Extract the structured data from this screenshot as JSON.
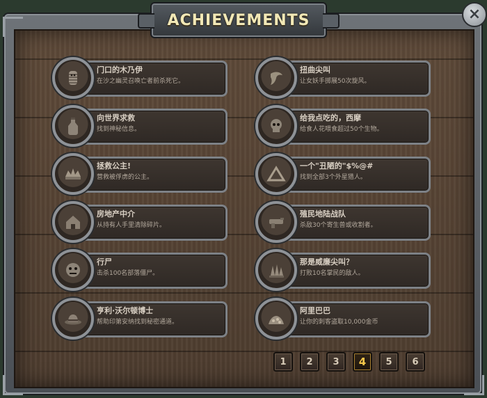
{
  "title": "ACHIEVEMENTS",
  "close_label": "×",
  "colors": {
    "wood": "#4d3c2f",
    "frame": "#6e7378",
    "active_page": "#f5c64a"
  },
  "achievements": [
    {
      "title": "门口的木乃伊",
      "desc": "在沙之幽灵召唤亡者前杀死它。",
      "icon": "mummy-icon"
    },
    {
      "title": "扭曲尖叫",
      "desc": "让女妖手掷展50次旋风。",
      "icon": "banshee-icon"
    },
    {
      "title": "向世界求救",
      "desc": "找到神秘信息。",
      "icon": "bottle-icon"
    },
    {
      "title": "给我点吃的，西摩",
      "desc": "给食人花喂食超过50个生物。",
      "icon": "skull-icon"
    },
    {
      "title": "拯救公主!",
      "desc": "营救被俘虏的公主。",
      "icon": "crown-icon"
    },
    {
      "title": "一个\"丑陋的\"$%@#",
      "desc": "找到全部3个外星猎人。",
      "icon": "triangle-icon"
    },
    {
      "title": "房地产中介",
      "desc": "从持有人手里清除碎片。",
      "icon": "house-icon"
    },
    {
      "title": "殖民地陆战队",
      "desc": "杀敌30个寄生兽或收割者。",
      "icon": "gun-icon"
    },
    {
      "title": "行尸",
      "desc": "击杀100名部落僵尸。",
      "icon": "zombie-icon"
    },
    {
      "title": "那是威廉尖叫？",
      "desc": "打败10名掌民的敌人。",
      "icon": "spikes-icon"
    },
    {
      "title": "亨利·沃尔顿博士",
      "desc": "帮助印第安纳找到秘密通道。",
      "icon": "hat-icon"
    },
    {
      "title": "阿里巴巴",
      "desc": "让你的刺客盗取10,000金币",
      "icon": "gold-icon"
    }
  ],
  "pages": [
    "1",
    "2",
    "3",
    "4",
    "5",
    "6"
  ],
  "active_page": "4"
}
